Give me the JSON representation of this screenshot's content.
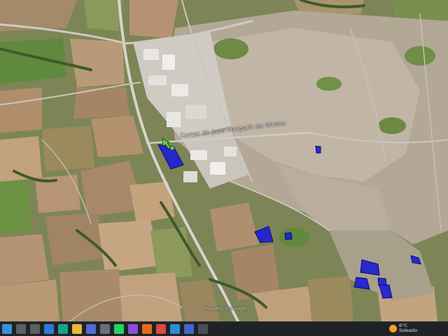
{
  "map": {
    "road_label": "Carrer de Joan Margarit de Girona",
    "credit": "Imagery ©Google",
    "marker_icon": "location-arrow-icon",
    "highlight_color": "#1f1fd0",
    "highlight_outline": "#0a0a7a",
    "parcel_count": 9
  },
  "taskbar": {
    "icons": [
      {
        "name": "start-button",
        "icon": "windows-logo-icon",
        "color": "#3c8fdd"
      },
      {
        "name": "search-button",
        "icon": "search-icon",
        "color": "#5a5f66"
      },
      {
        "name": "task-view-button",
        "icon": "task-view-icon",
        "color": "#5a5f66"
      },
      {
        "name": "app-photos",
        "icon": "photos-icon",
        "color": "#2e7bd6"
      },
      {
        "name": "app-edge",
        "icon": "edge-icon",
        "color": "#1aa38a"
      },
      {
        "name": "app-explorer",
        "icon": "folder-icon",
        "color": "#e8b73a"
      },
      {
        "name": "app-store",
        "icon": "store-icon",
        "color": "#4f6bd8"
      },
      {
        "name": "app-save",
        "icon": "save-icon",
        "color": "#6a6f78"
      },
      {
        "name": "app-whatsapp",
        "icon": "whatsapp-icon",
        "color": "#25d366"
      },
      {
        "name": "app-media",
        "icon": "media-icon",
        "color": "#8a4fd8"
      },
      {
        "name": "app-firefox",
        "icon": "firefox-icon",
        "color": "#e66a1e"
      },
      {
        "name": "app-chrome",
        "icon": "chrome-icon",
        "color": "#d94b3a"
      },
      {
        "name": "app-s",
        "icon": "s-letter-icon",
        "color": "#2a8ed6"
      },
      {
        "name": "app-a",
        "icon": "a-triangle-icon",
        "color": "#3f68c9"
      },
      {
        "name": "app-screen",
        "icon": "screen-icon",
        "color": "#4b5058"
      }
    ],
    "weather": {
      "temp": "6°C",
      "condition": "Soleado"
    },
    "clock": {
      "time": "",
      "date": ""
    }
  }
}
